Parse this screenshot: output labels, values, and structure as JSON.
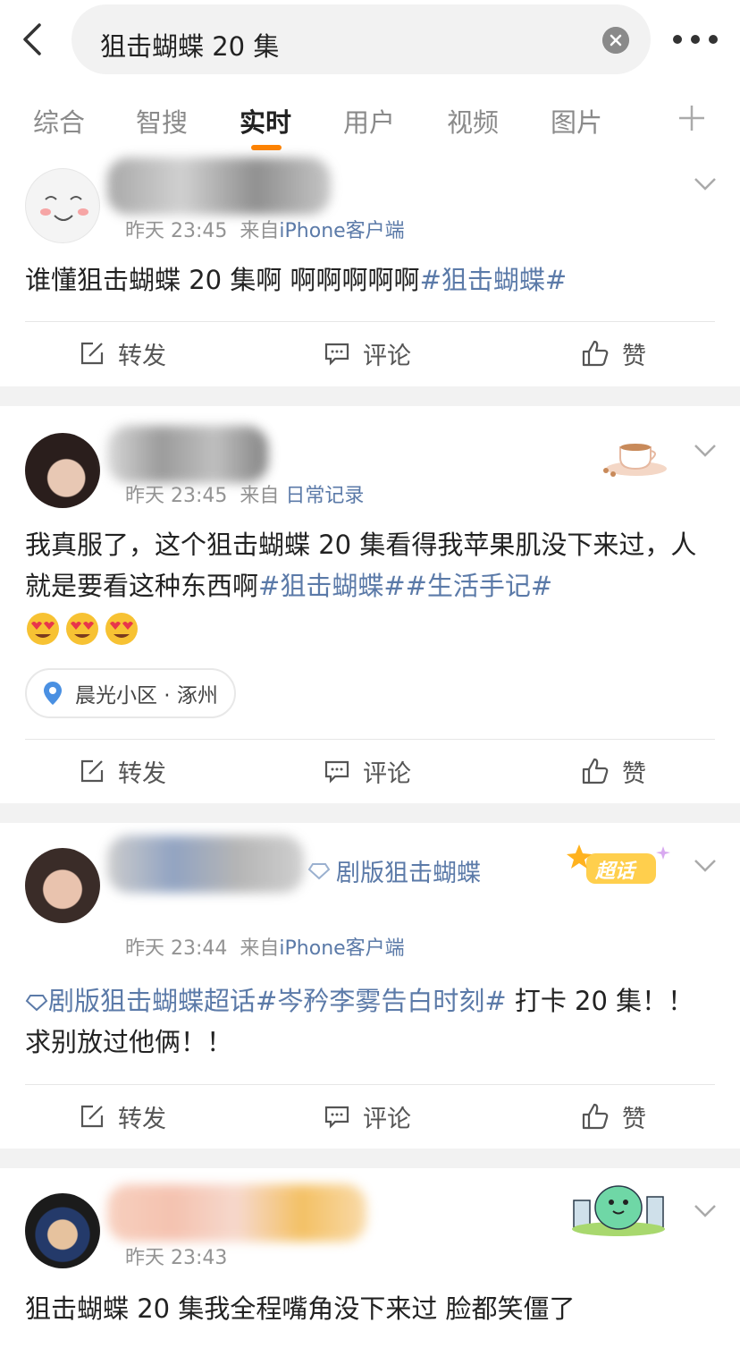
{
  "search": {
    "query": "狙击蝴蝶 20 集"
  },
  "tabs": [
    "综合",
    "智搜",
    "实时",
    "用户",
    "视频",
    "图片"
  ],
  "active_tab": "实时",
  "accent": "#ff8200",
  "link_color": "#5b7aa8",
  "actions": {
    "repost": "转发",
    "comment": "评论",
    "like": "赞"
  },
  "posts": [
    {
      "time": "昨天 23:45",
      "from": "来自",
      "source": "iPhone客户端",
      "text": "谁懂狙击蝴蝶 20 集啊  啊啊啊啊啊",
      "tags": [
        "#狙击蝴蝶#"
      ]
    },
    {
      "time": "昨天 23:45",
      "from": "来自",
      "source": "日常记录",
      "text": "我真服了，这个狙击蝴蝶 20 集看得我苹果肌没下来过，人就是要看这种东西啊",
      "tags": [
        "#狙击蝴蝶#",
        "#生活手记#"
      ],
      "location": "晨光小区 · 涿州"
    },
    {
      "time": "昨天 23:44",
      "from": "来自",
      "source": "iPhone客户端",
      "supertopic": "剧版狙击蝴蝶",
      "badge": "超话",
      "text_prefix_tag": "剧版狙击蝴蝶超话",
      "tags": [
        "#岑矜李雾告白时刻#"
      ],
      "text": " 打卡 20 集！！ 求别放过他俩！！"
    },
    {
      "time": "昨天 23:43",
      "text": "狙击蝴蝶 20 集我全程嘴角没下来过 脸都笑僵了"
    }
  ]
}
